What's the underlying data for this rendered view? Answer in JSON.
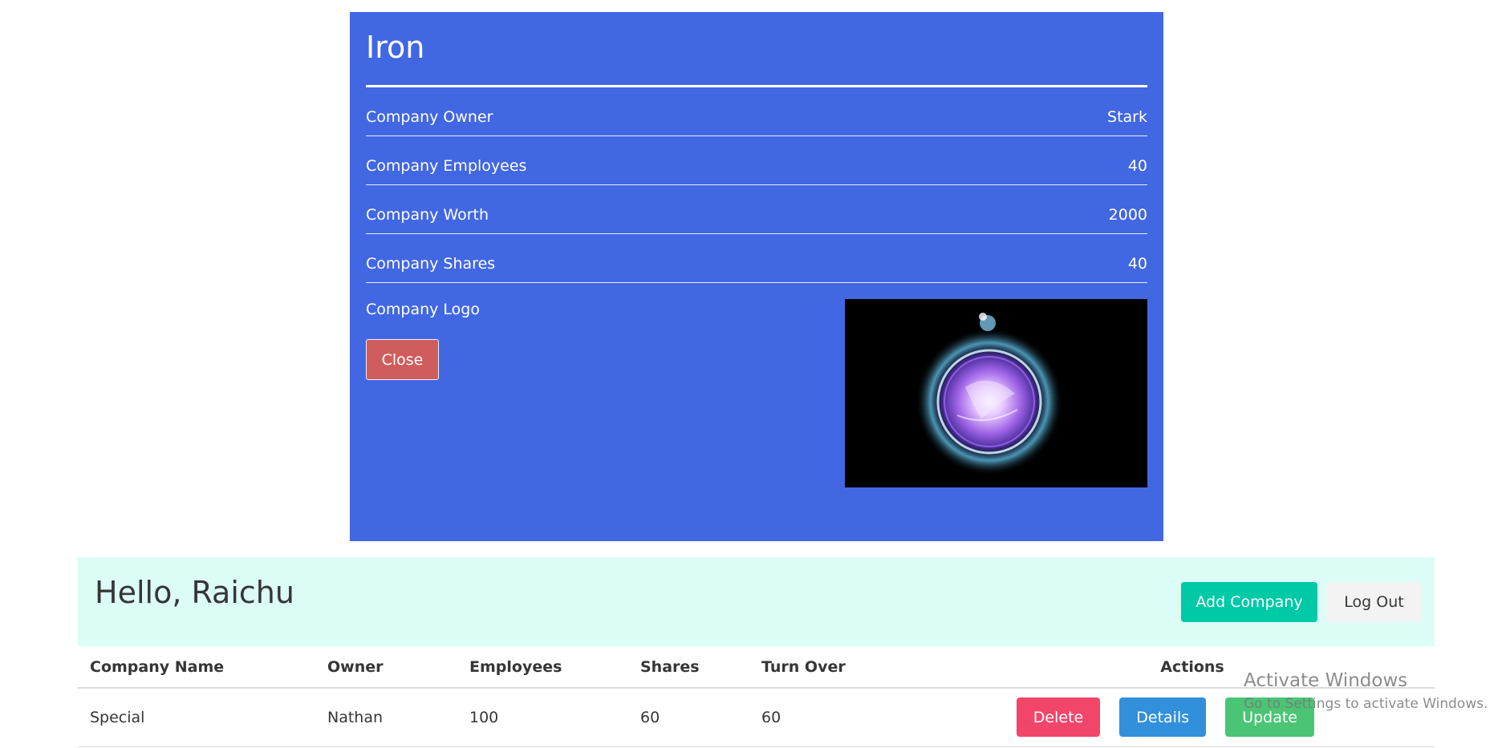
{
  "modal": {
    "title": "Iron",
    "fields": [
      {
        "label": "Company Owner",
        "value": "Stark"
      },
      {
        "label": "Company Employees",
        "value": "40"
      },
      {
        "label": "Company Worth",
        "value": "2000"
      },
      {
        "label": "Company Shares",
        "value": "40"
      }
    ],
    "logo_label": "Company Logo",
    "close_label": "Close",
    "background_color": "#4267e3",
    "close_color": "#d05d5d"
  },
  "header": {
    "greeting": "Hello, Raichu",
    "add_company_label": "Add Company",
    "logout_label": "Log Out",
    "background_color": "#dbfdf6",
    "add_company_color": "#00c9a6"
  },
  "table": {
    "columns": [
      "Company Name",
      "Owner",
      "Employees",
      "Shares",
      "Turn Over",
      "Actions"
    ],
    "rows": [
      {
        "name": "Special",
        "owner": "Nathan",
        "employees": "100",
        "shares": "60",
        "turnover": "60",
        "actions": {
          "delete": "Delete",
          "details": "Details",
          "update": "Update"
        }
      }
    ],
    "action_colors": {
      "delete": "#f1466a",
      "details": "#3290db",
      "update": "#4bc575"
    }
  },
  "watermark": {
    "title": "Activate Windows",
    "subtitle": "Go to Settings to activate Windows."
  }
}
